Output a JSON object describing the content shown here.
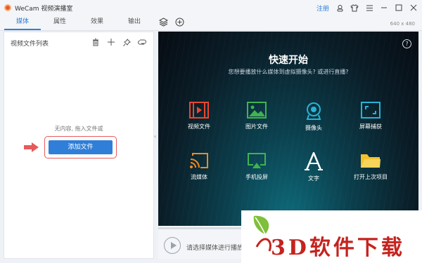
{
  "window": {
    "title": "WeCam 视频演播室",
    "register_label": "注册"
  },
  "tabs": [
    {
      "label": "媒体",
      "active": true
    },
    {
      "label": "属性",
      "active": false
    },
    {
      "label": "效果",
      "active": false
    },
    {
      "label": "输出",
      "active": false
    }
  ],
  "resolution": "640 x 480",
  "left_panel": {
    "title": "视频文件列表",
    "empty_text": "无内容, 拖入文件或",
    "add_button": "添加文件"
  },
  "quick_start": {
    "title": "快速开始",
    "subtitle": "您想要播放什么媒体到虚拟摄像头? 或进行直播?",
    "items": [
      {
        "label": "视频文件",
        "icon": "video-file-icon",
        "color": "#e8472f"
      },
      {
        "label": "图片文件",
        "icon": "image-file-icon",
        "color": "#3fb34f"
      },
      {
        "label": "摄像头",
        "icon": "webcam-icon",
        "color": "#27b3d6"
      },
      {
        "label": "屏幕捕获",
        "icon": "screen-capture-icon",
        "color": "#27b3d6"
      },
      {
        "label": "流媒体",
        "icon": "stream-media-icon",
        "color": "#f08a1f"
      },
      {
        "label": "手机投屏",
        "icon": "phone-cast-icon",
        "color": "#3fb34f"
      },
      {
        "label": "文字",
        "icon": "text-icon",
        "color": "#ffffff"
      },
      {
        "label": "打开上次项目",
        "icon": "folder-icon",
        "color": "#f3c22b"
      }
    ]
  },
  "player": {
    "prompt": "请选择媒体进行播放"
  },
  "watermark": {
    "text": "3D软件下载"
  }
}
